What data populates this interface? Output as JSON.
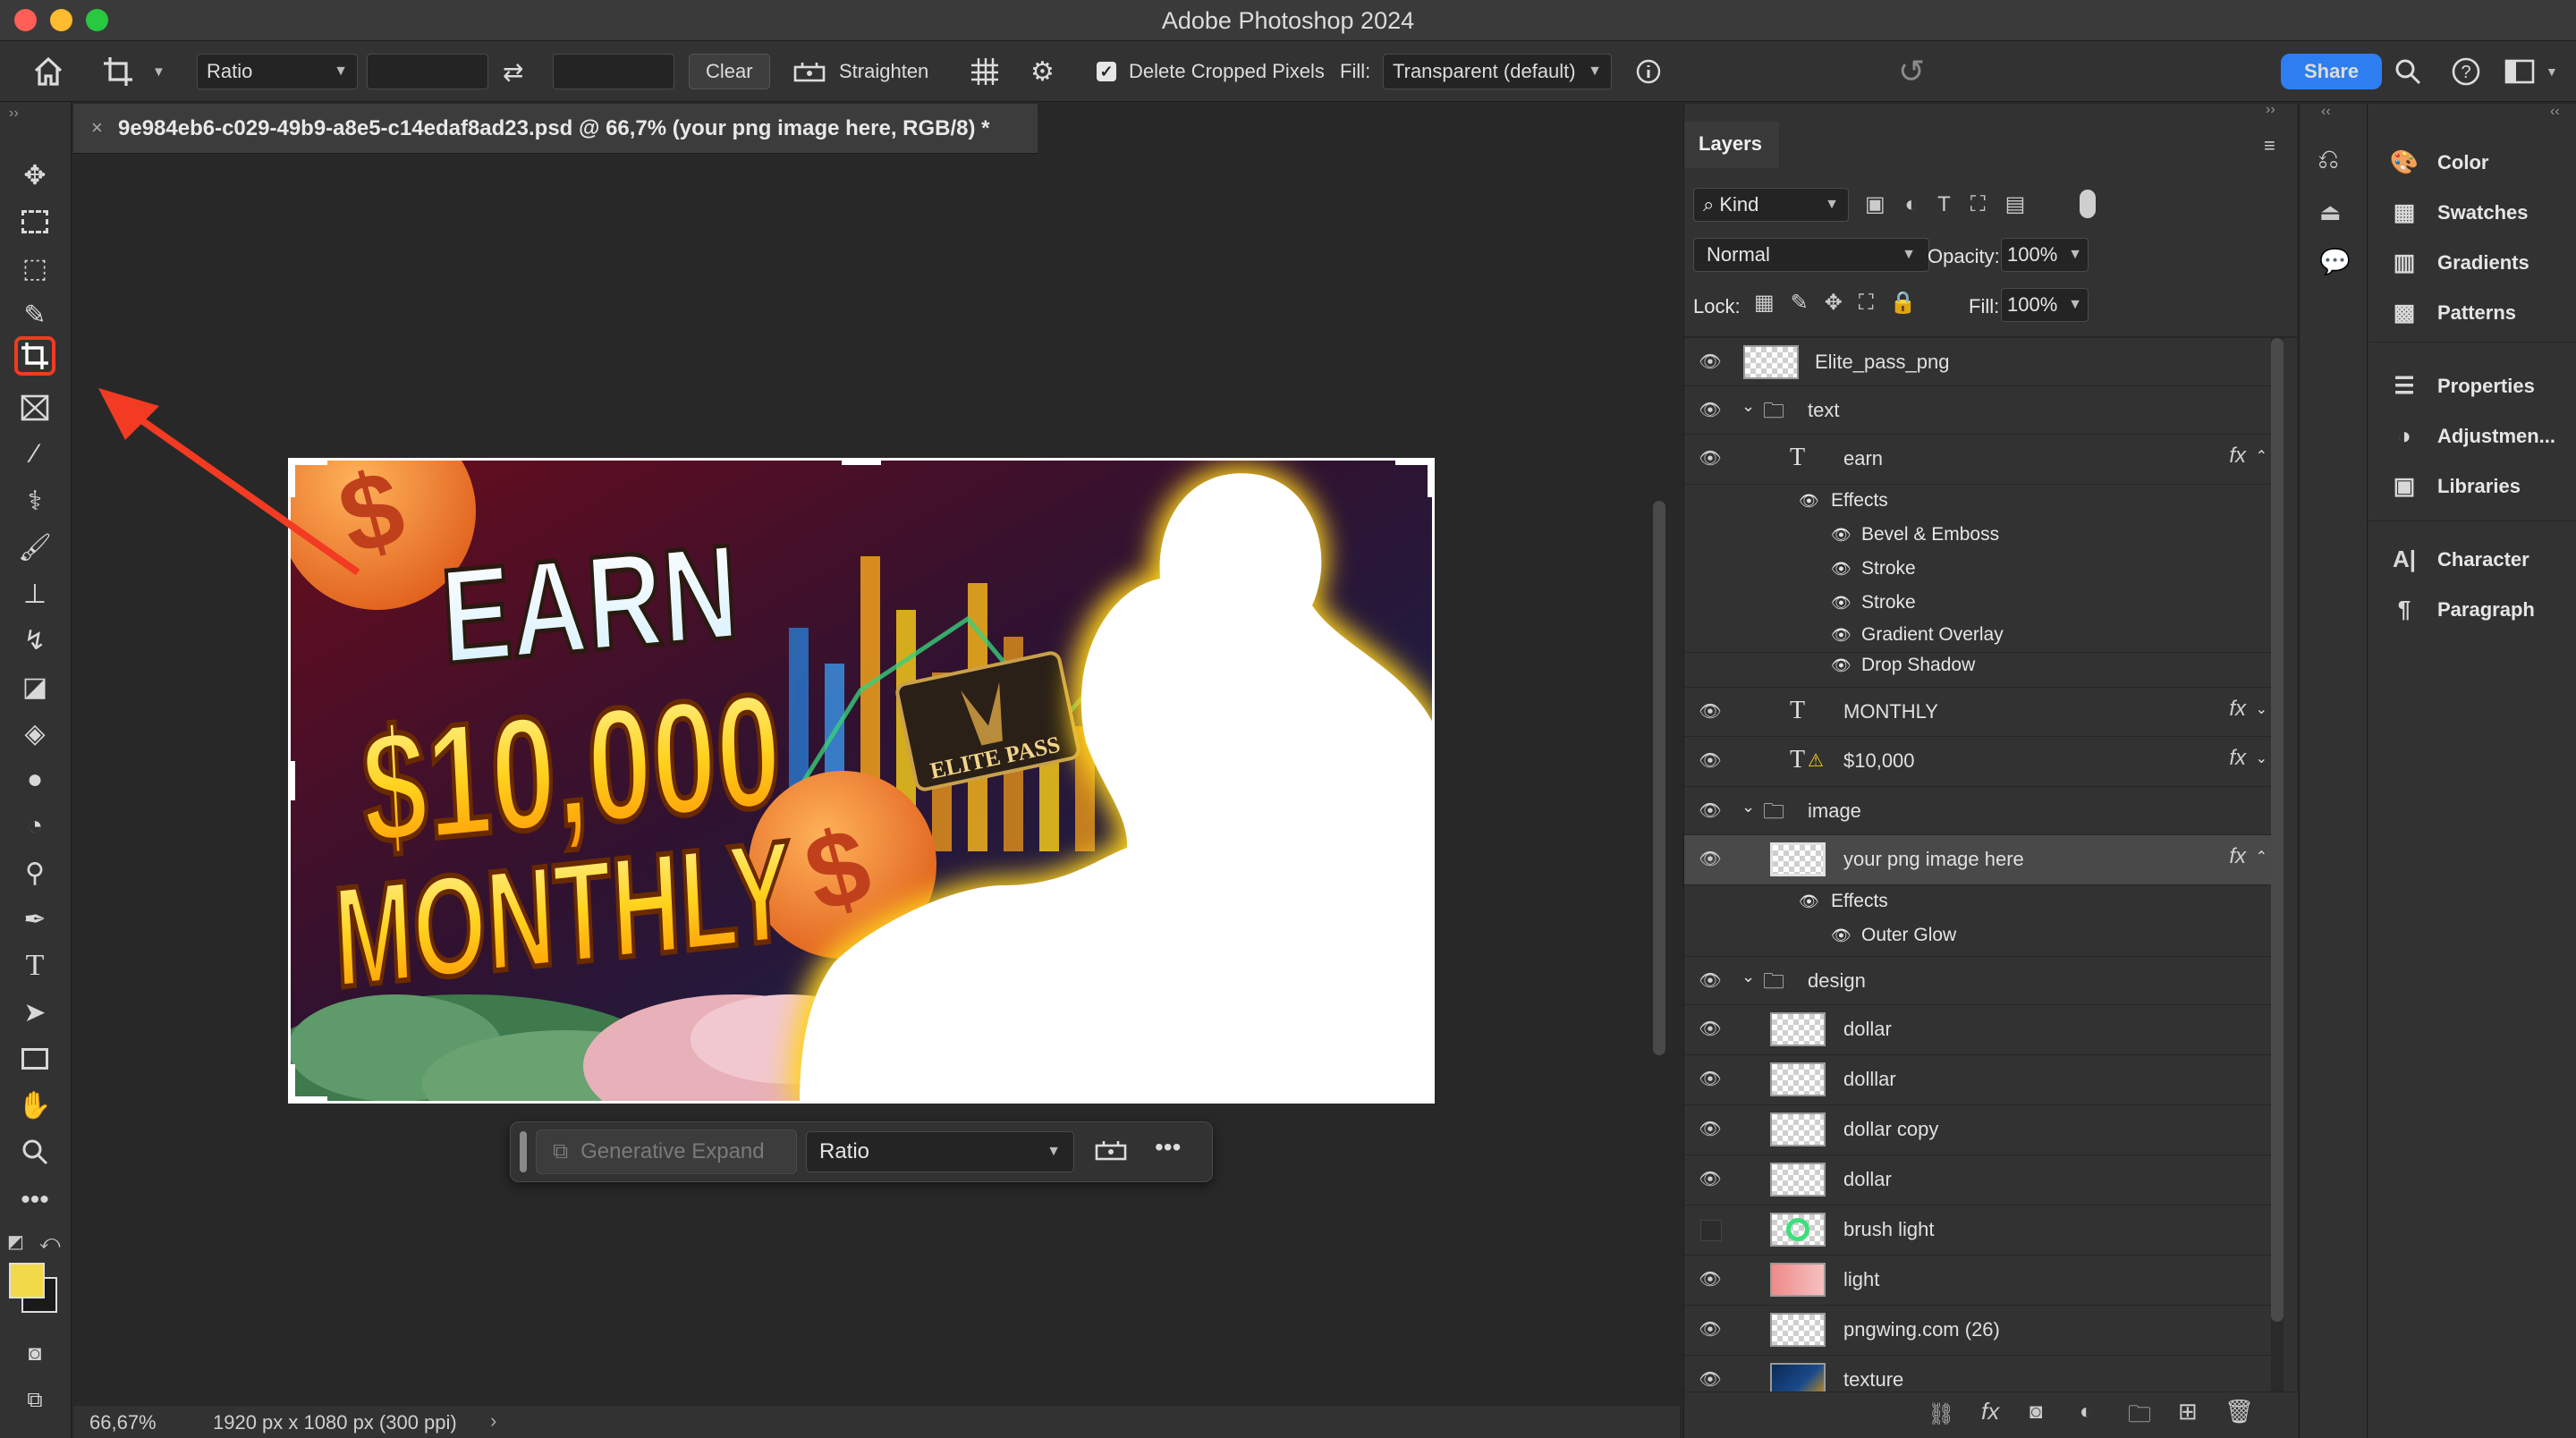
{
  "window": {
    "title": "Adobe Photoshop 2024"
  },
  "options_bar": {
    "ratio_label": "Ratio",
    "clear_label": "Clear",
    "straighten_label": "Straighten",
    "delete_cropped_label": "Delete Cropped Pixels",
    "delete_cropped_checked": true,
    "fill_label": "Fill:",
    "fill_value": "Transparent (default)",
    "share_label": "Share"
  },
  "document": {
    "tab_title": "9e984eb6-c029-49b9-a8e5-c14edaf8ad23.psd @ 66,7% (your png image here, RGB/8) *"
  },
  "status": {
    "zoom": "66,67%",
    "doc_info": "1920 px x 1080 px (300 ppi)"
  },
  "artwork": {
    "line1": "EARN",
    "line2": "$10,000",
    "line3": "MONTHLY",
    "badge_text": "ELITE PASS",
    "coin_symbol": "$"
  },
  "task_bar": {
    "generative_expand": "Generative Expand",
    "ratio_value": "Ratio"
  },
  "layers_panel": {
    "tab": "Layers",
    "filter_kind": "Kind",
    "blend_mode": "Normal",
    "opacity_label": "Opacity:",
    "opacity_value": "100%",
    "lock_label": "Lock:",
    "fill_label": "Fill:",
    "fill_value": "100%",
    "layers": [
      {
        "name": "Elite_pass_png",
        "kind": "image",
        "visible": true
      },
      {
        "name": "text",
        "kind": "group",
        "visible": true
      },
      {
        "name": "earn",
        "kind": "text",
        "visible": true,
        "fx": true
      },
      {
        "name": "Effects",
        "kind": "effects-header"
      },
      {
        "name": "Bevel & Emboss",
        "kind": "effect"
      },
      {
        "name": "Stroke",
        "kind": "effect"
      },
      {
        "name": "Stroke",
        "kind": "effect"
      },
      {
        "name": "Gradient Overlay",
        "kind": "effect"
      },
      {
        "name": "Drop Shadow",
        "kind": "effect"
      },
      {
        "name": "MONTHLY",
        "kind": "text",
        "visible": true,
        "fx": true
      },
      {
        "name": "$10,000",
        "kind": "text-warning",
        "visible": true,
        "fx": true
      },
      {
        "name": "image",
        "kind": "group",
        "visible": true
      },
      {
        "name": "your png image here",
        "kind": "smart",
        "visible": true,
        "fx": true,
        "selected": true
      },
      {
        "name": "Effects",
        "kind": "effects-header"
      },
      {
        "name": "Outer Glow",
        "kind": "effect"
      },
      {
        "name": "design",
        "kind": "group",
        "visible": true
      },
      {
        "name": "dollar",
        "kind": "image",
        "visible": true
      },
      {
        "name": "dolllar",
        "kind": "image",
        "visible": true
      },
      {
        "name": "dollar copy",
        "kind": "image",
        "visible": true
      },
      {
        "name": "dollar",
        "kind": "image",
        "visible": true
      },
      {
        "name": "brush light",
        "kind": "image",
        "visible": false
      },
      {
        "name": "light",
        "kind": "image",
        "visible": true
      },
      {
        "name": "pngwing.com (26)",
        "kind": "smart",
        "visible": true
      },
      {
        "name": "texture",
        "kind": "image",
        "visible": true
      }
    ]
  },
  "library_panel": {
    "items": [
      "Color",
      "Swatches",
      "Gradients",
      "Patterns",
      "Properties",
      "Adjustmen...",
      "Libraries",
      "Character",
      "Paragraph"
    ]
  },
  "colors": {
    "accent": "#2d7ef0",
    "highlight": "#f23b22",
    "foreground": "#f2d94a",
    "background": "#1a1a1a"
  }
}
